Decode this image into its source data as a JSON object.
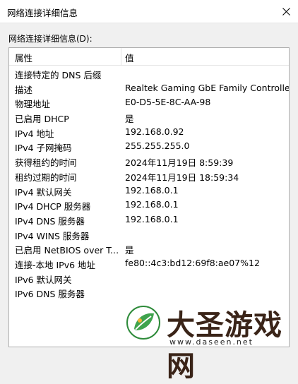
{
  "window": {
    "title": "网络连接详细信息"
  },
  "group_label": "网络连接详细信息(D):",
  "columns": [
    "属性",
    "值"
  ],
  "rows": [
    {
      "prop": "连接特定的 DNS 后缀",
      "val": ""
    },
    {
      "prop": "描述",
      "val": "Realtek Gaming GbE Family Controller"
    },
    {
      "prop": "物理地址",
      "val": "E0-D5-5E-8C-AA-98"
    },
    {
      "prop": "已启用 DHCP",
      "val": "是"
    },
    {
      "prop": "IPv4 地址",
      "val": "192.168.0.92"
    },
    {
      "prop": "IPv4 子网掩码",
      "val": "255.255.255.0"
    },
    {
      "prop": "获得租约的时间",
      "val": "2024年11月19日 8:59:39"
    },
    {
      "prop": "租约过期的时间",
      "val": "2024年11月19日 18:59:34"
    },
    {
      "prop": "IPv4 默认网关",
      "val": "192.168.0.1"
    },
    {
      "prop": "IPv4 DHCP 服务器",
      "val": "192.168.0.1"
    },
    {
      "prop": "IPv4 DNS 服务器",
      "val": "192.168.0.1"
    },
    {
      "prop": "IPv4 WINS 服务器",
      "val": ""
    },
    {
      "prop": "已启用 NetBIOS over Tc...",
      "val": "是"
    },
    {
      "prop": "连接-本地 IPv6 地址",
      "val": "fe80::4c3:bd12:69f8:ae07%12"
    },
    {
      "prop": "IPv6 默认网关",
      "val": ""
    },
    {
      "prop": "IPv6 DNS 服务器",
      "val": ""
    }
  ],
  "watermark": {
    "text": "大圣游戏网",
    "url": "www.daseen.net"
  },
  "colors": {
    "window_bg": "#f0f0f0",
    "list_bg": "#ffffff",
    "border": "#adadad"
  },
  "icons": {
    "close": "close-icon",
    "watermark_logo": "leaf-logo-icon"
  }
}
